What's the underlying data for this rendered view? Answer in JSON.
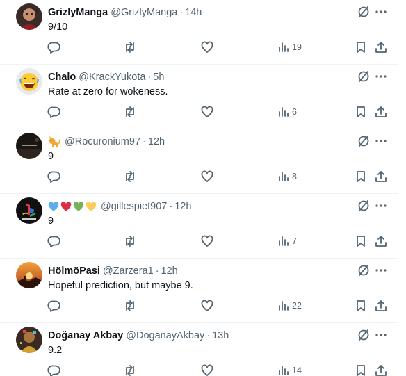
{
  "colors": {
    "text_primary": "#0f1419",
    "text_secondary": "#536471",
    "divider": "#eff3f4"
  },
  "tweets": [
    {
      "name": "GrizlyManga",
      "handle": "@GrizlyManga",
      "separator": "·",
      "time": "14h",
      "text": "9/10",
      "views": "19",
      "avatar": "anime-character-avatar"
    },
    {
      "name": "Chalo",
      "handle": "@KrackYukota",
      "separator": "·",
      "time": "5h",
      "text": "Rate at zero for wokeness.",
      "views": "6",
      "avatar": "laughing-emoji-avatar"
    },
    {
      "name": "",
      "name_emojis": [
        "cat-emoji"
      ],
      "handle": "@Rocuronium97",
      "separator": "·",
      "time": "12h",
      "text": "9",
      "views": "8",
      "avatar": "dark-poster-avatar"
    },
    {
      "name": "",
      "name_emojis": [
        "blue-heart-emoji",
        "red-heart-emoji",
        "green-heart-emoji",
        "yellow-heart-emoji"
      ],
      "handle": "@gillespiet907",
      "separator": "·",
      "time": "12h",
      "text": "9",
      "views": "7",
      "avatar": "playstation-logo-avatar"
    },
    {
      "name": "HölmöPasi",
      "handle": "@Zarzera1",
      "separator": "·",
      "time": "12h",
      "text": "Hopeful prediction, but maybe 9.",
      "views": "22",
      "avatar": "sunset-avatar"
    },
    {
      "name": "Doğanay Akbay",
      "handle": "@DoganayAkbay",
      "separator": "·",
      "time": "13h",
      "text": "9.2",
      "views": "14",
      "avatar": "colorful-character-avatar"
    }
  ]
}
